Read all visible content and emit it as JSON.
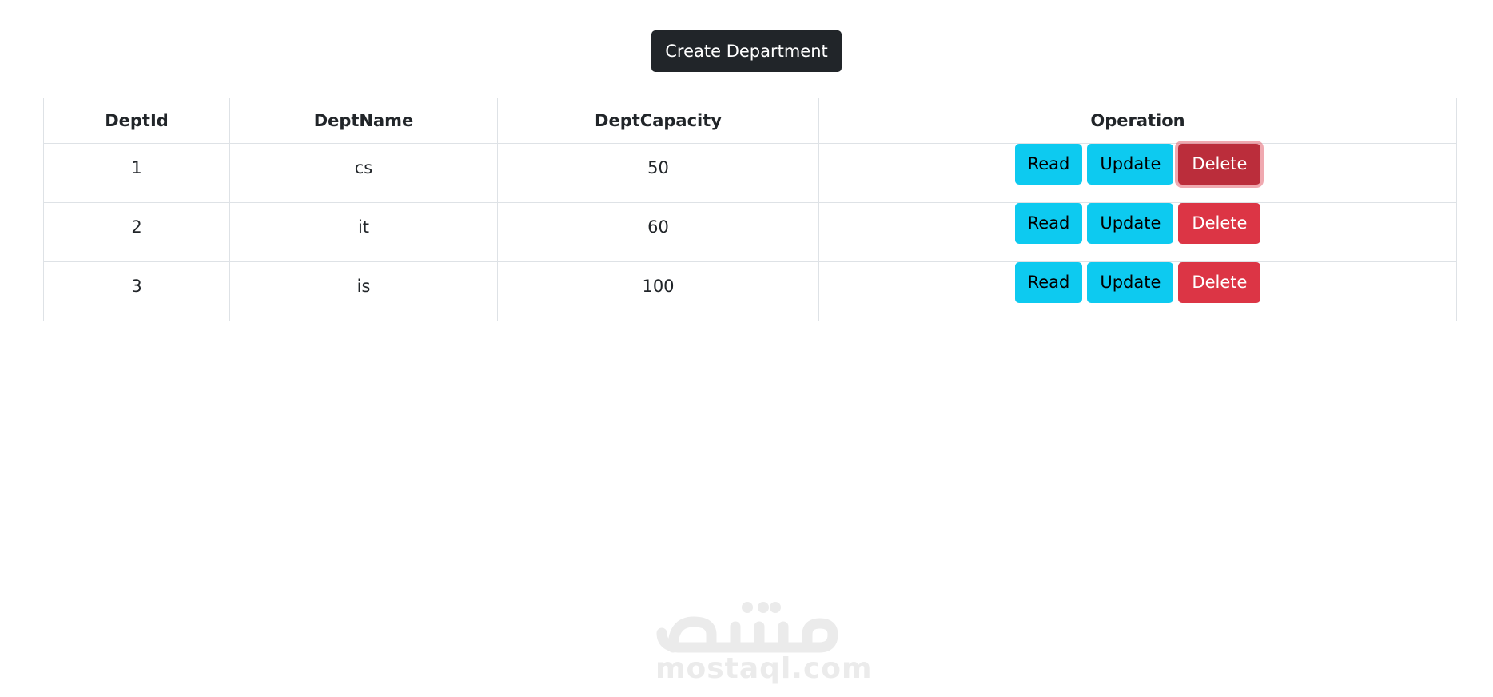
{
  "toolbar": {
    "create_label": "Create Department"
  },
  "table": {
    "headers": [
      "DeptId",
      "DeptName",
      "DeptCapacity",
      "Operation"
    ],
    "rows": [
      {
        "id": "1",
        "name": "cs",
        "capacity": "50"
      },
      {
        "id": "2",
        "name": "it",
        "capacity": "60"
      },
      {
        "id": "3",
        "name": "is",
        "capacity": "100"
      }
    ],
    "actions": {
      "read_label": "Read",
      "update_label": "Update",
      "delete_label": "Delete"
    }
  },
  "watermark": {
    "text": "mostaql.com",
    "logo_text": "مستقل"
  },
  "colors": {
    "dark_button": "#212529",
    "info_button": "#0dcaf0",
    "danger_button": "#dc3545",
    "danger_focused": "#bb2d3b",
    "border": "#dee2e6"
  }
}
